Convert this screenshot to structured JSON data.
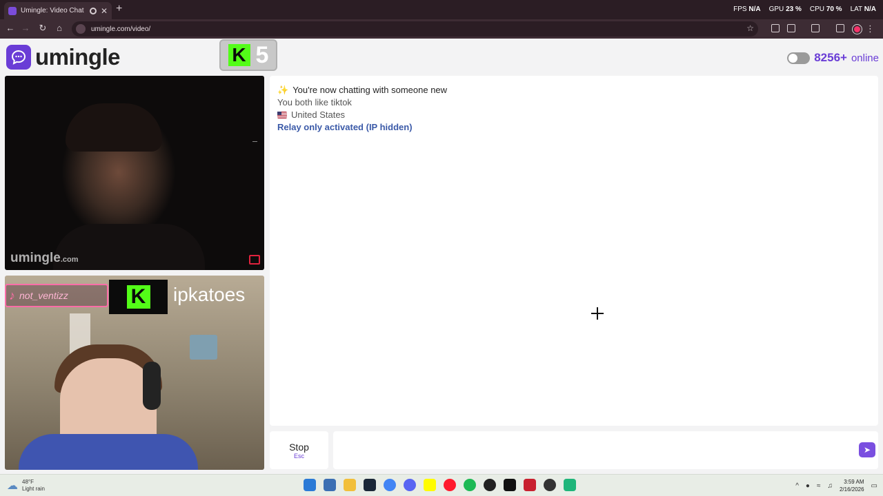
{
  "browser": {
    "tab_title": "Umingle: Video Chat with S",
    "tab_close": "✕",
    "new_tab": "+",
    "url": "umingle.com/video/",
    "perf": [
      {
        "label": "FPS",
        "value": "N/A"
      },
      {
        "label": "GPU",
        "value": "23 %"
      },
      {
        "label": "CPU",
        "value": "70 %"
      },
      {
        "label": "LAT",
        "value": "N/A"
      }
    ]
  },
  "header": {
    "logo_text": "umingle",
    "kick_overlay_letter": "K",
    "kick_overlay_number": "5",
    "online_count": "8256+",
    "online_label": "online"
  },
  "stranger_video": {
    "watermark": "umingle",
    "watermark_suffix": ".com"
  },
  "self_video": {
    "tiktok_handle": "not_ventizz",
    "kick_letter": "K",
    "kick_username": "ipkatoes"
  },
  "chat": {
    "line1": "You're now chatting with someone new",
    "line2": "You both like tiktok",
    "line3": "United States",
    "line4": "Relay only activated (IP hidden)"
  },
  "controls": {
    "stop_label": "Stop",
    "stop_key": "Esc",
    "message_placeholder": ""
  },
  "taskbar": {
    "weather_temp": "48°F",
    "weather_desc": "Light rain",
    "time": "3:59 AM",
    "date": "2/16/2026"
  },
  "colors": {
    "brand": "#6a3dd6",
    "kick_green": "#53fc18",
    "relay_blue": "#3b5aa8"
  }
}
